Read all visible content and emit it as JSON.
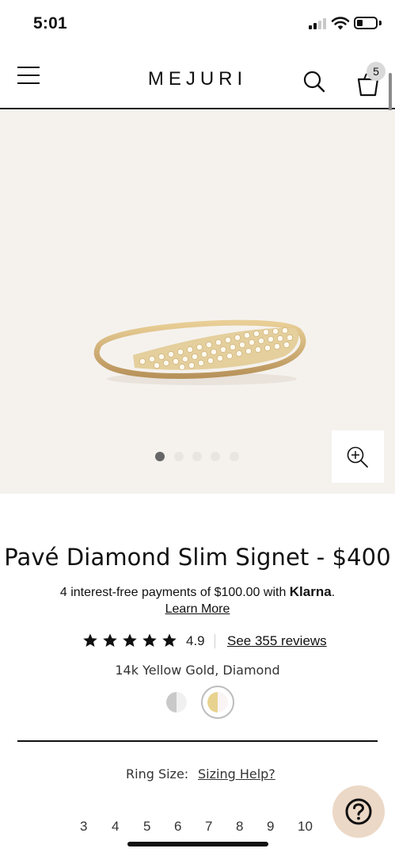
{
  "status_bar": {
    "time": "5:01",
    "icons": [
      "signal-icon",
      "wifi-icon",
      "battery-icon"
    ]
  },
  "header": {
    "logo": "MEJURI",
    "icons": [
      "menu-icon",
      "search-icon",
      "cart-icon"
    ],
    "cart_count": "5"
  },
  "gallery": {
    "image": "ring-image",
    "image_count": 5,
    "active_index": 0,
    "zoom_icon": "zoom-in-icon"
  },
  "product": {
    "title": "Pavé Diamond Slim Signet - $400",
    "payments_text": "4 interest-free payments of $100.00 with ",
    "payments_brand": "Klarna",
    "payments_suffix": ".",
    "learn_more": "Learn More",
    "rating": "4.9",
    "star_count": 5,
    "reviews_link": "See 355 reviews",
    "material": "14k Yellow Gold, Diamond",
    "colors": {
      "silver": "#c9c9c9",
      "gold": "#e8d28f",
      "accent_bg": "#f5f2ee",
      "help_bg": "#ecd8c6"
    }
  },
  "sizing": {
    "label": "Ring Size:",
    "help_link": "Sizing Help?",
    "sizes": [
      "3",
      "4",
      "5",
      "6",
      "7",
      "8",
      "9",
      "10"
    ]
  },
  "help_button": {
    "icon": "question-icon"
  }
}
